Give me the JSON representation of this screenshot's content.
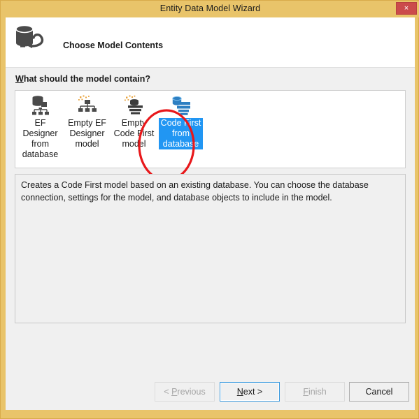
{
  "window": {
    "title": "Entity Data Model Wizard",
    "close_label": "×",
    "titlebar_color": "#e9c46a",
    "close_color": "#cb4b4b"
  },
  "header": {
    "heading": "Choose Model Contents",
    "icon": "database-plug-icon"
  },
  "main": {
    "section_label_accel": "W",
    "section_label_rest": "hat should the model contain?",
    "models": [
      {
        "id": "ef-designer-from-database",
        "label": "EF Designer from database",
        "icon": "database-hierarchy-icon",
        "selected": false
      },
      {
        "id": "empty-ef-designer-model",
        "label": "Empty EF Designer model",
        "icon": "sparkle-hierarchy-icon",
        "selected": false
      },
      {
        "id": "empty-code-first-model",
        "label": "Empty Code First model",
        "icon": "sparkle-layers-icon",
        "selected": false
      },
      {
        "id": "code-first-from-database",
        "label": "Code First from database",
        "icon": "blue-database-layers-icon",
        "selected": true
      }
    ],
    "selection_highlight_color": "#2196f3",
    "description": "Creates a Code First model based on an existing database. You can choose the database connection, settings for the model, and database objects to include in the model.",
    "annotation": {
      "shape": "ellipse",
      "color": "#e8181b",
      "targets": "code-first-from-database"
    }
  },
  "footer": {
    "buttons": [
      {
        "id": "previous",
        "prefix": "< ",
        "accel": "P",
        "rest": "revious",
        "state": "disabled"
      },
      {
        "id": "next",
        "prefix": "",
        "accel": "N",
        "rest": "ext >",
        "state": "focused"
      },
      {
        "id": "finish",
        "prefix": "",
        "accel": "F",
        "rest": "inish",
        "state": "disabled"
      },
      {
        "id": "cancel",
        "prefix": "",
        "accel": "",
        "rest": "Cancel",
        "state": "normal"
      }
    ]
  }
}
